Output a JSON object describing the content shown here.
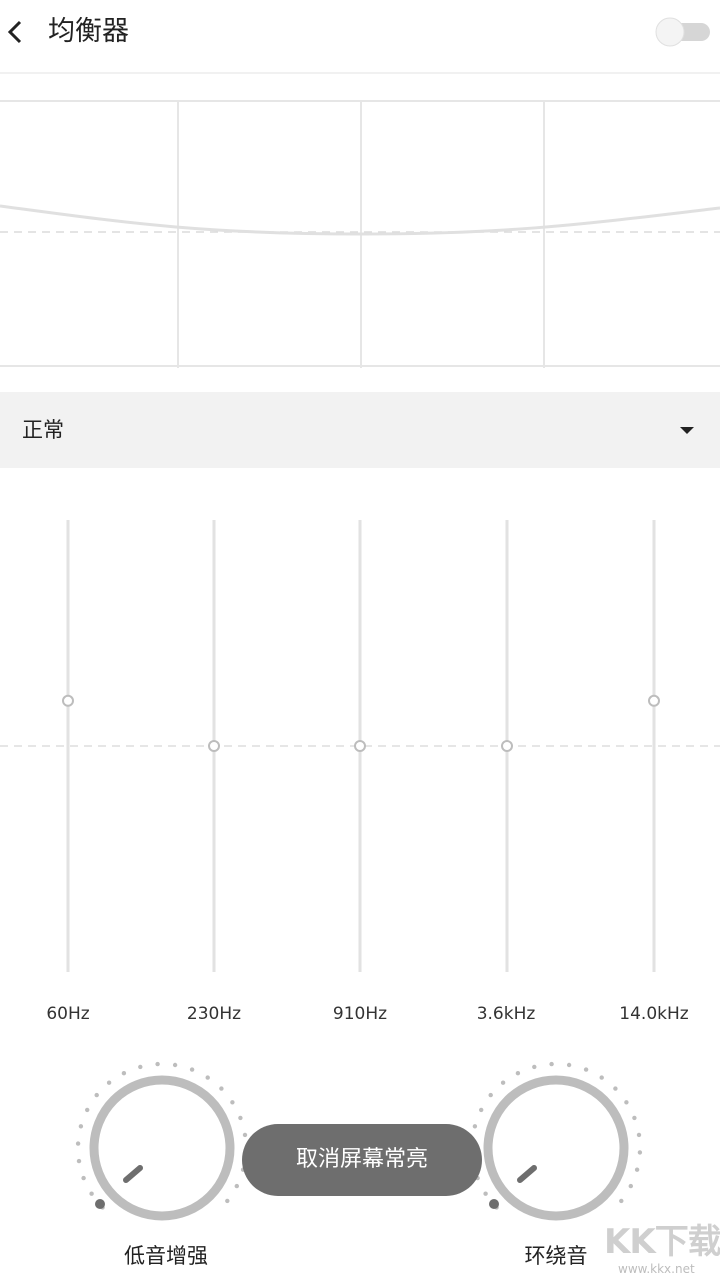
{
  "header": {
    "title": "均衡器",
    "back_icon": "chevron-left-icon",
    "toggle_state": "off"
  },
  "preset": {
    "selected": "正常",
    "arrow_icon": "caret-down-icon"
  },
  "equalizer": {
    "bands": [
      {
        "label": "60Hz",
        "level": 0.2
      },
      {
        "label": "230Hz",
        "level": 0.0
      },
      {
        "label": "910Hz",
        "level": 0.0
      },
      {
        "label": "3.6kHz",
        "level": 0.0
      },
      {
        "label": "14.0kHz",
        "level": 0.2
      }
    ]
  },
  "knobs": {
    "bass": {
      "label": "低音增强",
      "level": 0.0
    },
    "surround": {
      "label": "环绕音",
      "level": 0.0
    }
  },
  "toast": {
    "text": "取消屏幕常亮"
  },
  "watermark": {
    "logo": "KK下载",
    "url": "www.kkx.net"
  },
  "colors": {
    "line": "#e2e2e2",
    "knob_ring": "#bdbdbd",
    "toast_bg": "#6e6e6e",
    "preset_bg": "#f2f2f2"
  }
}
